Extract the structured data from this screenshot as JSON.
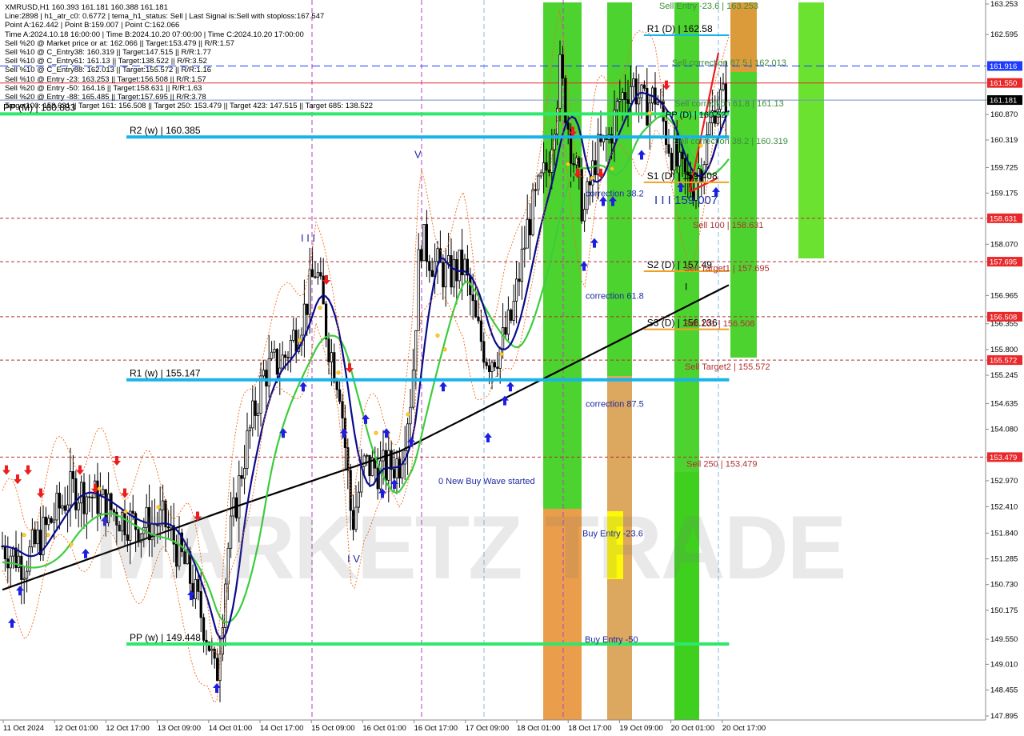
{
  "header": {
    "lines": [
      "XMRUSD,H1  160.393 161.181 160.388 161.181",
      "Line:2898 | h1_atr_c0: 0.6772 | tema_h1_status: Sell | Last Signal is:Sell with stoploss:167.547",
      "Point A:162.442 | Point B:159.007 | Point C:162.066",
      "Time A:2024.10.18 16:00:00 | Time B:2024.10.20 07:00:00 | Time C:2024.10.20 17:00:00",
      "Sell %20 @ Market price or at: 162.066 || Target:153.479 || R/R:1.57",
      "Sell %10 @ C_Entry38: 160.319 || Target:147.515 || R/R:1.77",
      "Sell %10 @ C_Entry61: 161.13 || Target:138.522 || R/R:3.52",
      "Sell %10 @ C_Entry88: 162.013 || Target:155.572 || R/R:1.16",
      "Sell %10 @ Entry -23: 163.253 || Target:156.508 || R/R:1.57",
      "Sell %20 @ Entry -50: 164.16 || Target:158.631 || R/R:1.63",
      "Sell %20 @ Entry -88: 165.485 || Target:157.695 || R/R:3.78",
      "Target100: 158.631 || Target 161: 156.508 || Target 250: 153.479 || Target 423: 147.515 || Target 685: 138.522"
    ]
  },
  "watermark": "MARKETZ TRADE",
  "chart_data": {
    "type": "candlestick",
    "symbol": "XMRUSD",
    "timeframe": "H1",
    "ylim": [
      147.895,
      163.253
    ],
    "y_ticks": [
      163.253,
      162.595,
      161.916,
      161.55,
      161.181,
      160.87,
      160.319,
      159.725,
      159.175,
      158.631,
      158.07,
      157.695,
      156.965,
      156.508,
      156.355,
      155.8,
      155.572,
      155.245,
      154.635,
      154.08,
      153.479,
      152.97,
      152.41,
      151.84,
      151.285,
      150.73,
      150.175,
      149.55,
      149.01,
      148.455,
      147.895
    ],
    "x_ticks": [
      "11 Oct 2024",
      "12 Oct 01:00",
      "12 Oct 17:00",
      "13 Oct 09:00",
      "14 Oct 01:00",
      "14 Oct 17:00",
      "15 Oct 09:00",
      "16 Oct 01:00",
      "16 Oct 17:00",
      "17 Oct 09:00",
      "18 Oct 01:00",
      "18 Oct 17:00",
      "19 Oct 09:00",
      "20 Oct 01:00",
      "20 Oct 17:00"
    ],
    "price_tags": [
      {
        "value": 161.916,
        "text": "161.916",
        "color": "#1e3cff"
      },
      {
        "value": 161.55,
        "text": "161.550",
        "color": "#e8282a"
      },
      {
        "value": 161.181,
        "text": "161.181",
        "color": "#000000"
      },
      {
        "value": 158.631,
        "text": "158.631",
        "color": "#e8282a"
      },
      {
        "value": 157.695,
        "text": "157.695",
        "color": "#e8282a"
      },
      {
        "value": 156.508,
        "text": "156.508",
        "color": "#e8282a"
      },
      {
        "value": 155.572,
        "text": "155.572",
        "color": "#e8282a"
      },
      {
        "value": 153.479,
        "text": "153.479",
        "color": "#e8282a"
      }
    ],
    "levels": [
      {
        "label": "PP (M) | 160.883",
        "value": 160.883,
        "color": "#2ee86a",
        "x0": 0.0,
        "x1": 0.713
      },
      {
        "label": "R2 (w) | 160.385",
        "value": 160.385,
        "color": "#17b4ea",
        "x0": 0.125,
        "x1": 0.713
      },
      {
        "label": "R1 (w) | 155.147",
        "value": 155.147,
        "color": "#17b4ea",
        "x0": 0.125,
        "x1": 0.713
      },
      {
        "label": "PP (w) | 149.448",
        "value": 149.448,
        "color": "#2ee86a",
        "x0": 0.125,
        "x1": 0.713
      },
      {
        "label": "R1 (D) | 162.58",
        "value": 162.58,
        "color": "#17b4ea",
        "x0": 0.65,
        "x1": 0.713
      },
      {
        "label": "S1 (D) | 159.408",
        "value": 159.408,
        "color": "#f0a020",
        "x0": 0.65,
        "x1": 0.713
      },
      {
        "label": "S2 (D) | 157.49",
        "value": 157.49,
        "color": "#f0a020",
        "x0": 0.65,
        "x1": 0.713
      },
      {
        "label": "S3 (D) | 156.236",
        "value": 156.236,
        "color": "#f0a020",
        "x0": 0.65,
        "x1": 0.713
      }
    ],
    "dashed_lines": [
      {
        "value": 161.916,
        "color": "#1e3cff"
      },
      {
        "value": 161.55,
        "color": "#e8282a",
        "solid": true
      },
      {
        "value": 161.181,
        "color": "#7090c0",
        "solid": true
      },
      {
        "value": 158.631,
        "color": "#b03030"
      },
      {
        "value": 157.695,
        "color": "#b03030"
      },
      {
        "value": 156.508,
        "color": "#b03030"
      },
      {
        "value": 155.572,
        "color": "#b03030"
      },
      {
        "value": 153.479,
        "color": "#b03030"
      }
    ],
    "annotations": [
      {
        "text": "Sell Entry -23.6 | 163.253",
        "color": "#3c8c3c",
        "value": 163.253
      },
      {
        "text": "Sell correction 87.5 | 162.013",
        "color": "#3c8c3c",
        "value": 162.013
      },
      {
        "text": "Sell correction 61.8 | 161.13",
        "color": "#3c8c3c",
        "value": 161.13
      },
      {
        "text": "Sell correction 38.2 | 160.319",
        "color": "#3c8c3c",
        "value": 160.319
      },
      {
        "text": "Sell 100 | 158.631",
        "color": "#b03030",
        "value": 158.631
      },
      {
        "text": "Sell Target1 | 157.695",
        "color": "#b03030",
        "value": 157.695
      },
      {
        "text": "Sell 161 | 156.508",
        "color": "#b03030",
        "value": 156.508
      },
      {
        "text": "Sell Target2 | 155.572",
        "color": "#b03030",
        "value": 155.572
      },
      {
        "text": "Sell 250 | 153.479",
        "color": "#b03030",
        "value": 153.479
      },
      {
        "text": "I I I  159.007",
        "color": "#1e2aa0",
        "value": 159.007
      },
      {
        "text": "correction 38.2",
        "color": "#1e2aa0",
        "value": 159.175
      },
      {
        "text": "correction 61.8",
        "color": "#1e2aa0",
        "value": 156.965
      },
      {
        "text": "correction 87.5",
        "color": "#1e2aa0",
        "value": 154.635
      },
      {
        "text": "0 New Buy Wave started",
        "color": "#1e2aa0",
        "value": 152.97
      },
      {
        "text": "Buy Entry -23.6",
        "color": "#1e2aa0",
        "value": 151.84
      },
      {
        "text": "Buy Entry -50",
        "color": "#1e2aa0",
        "value": 149.55
      },
      {
        "text": "I I I",
        "color": "#1e2aa0",
        "value": 158.2
      },
      {
        "text": "V",
        "color": "#1e2aa0",
        "value": 160.0
      },
      {
        "text": "I V",
        "color": "#1e2aa0",
        "value": 151.28
      },
      {
        "text": "I",
        "color": "#000000",
        "value": 157.15
      },
      {
        "text": "PP (D) | 160.52",
        "color": "#000000",
        "value": 160.87
      }
    ]
  }
}
